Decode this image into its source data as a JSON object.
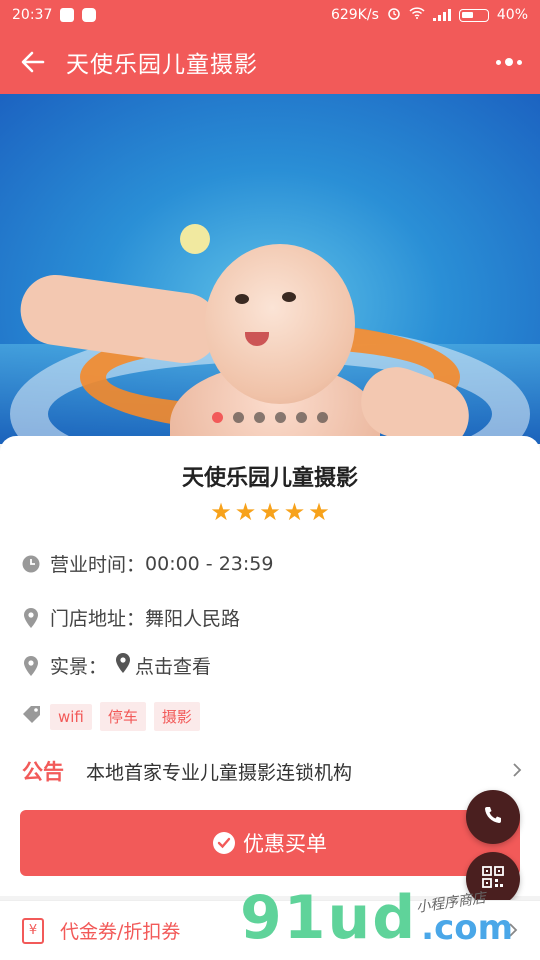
{
  "status_bar": {
    "time": "20:37",
    "network_speed": "629K/s",
    "battery": "40%",
    "icons": [
      "shield-app-icon",
      "wechat-icon",
      "alarm-icon",
      "wifi-icon",
      "signal-icon",
      "battery-icon"
    ]
  },
  "nav": {
    "title": "天使乐园儿童摄影",
    "back_icon": "back-arrow-icon",
    "more_icon": "more-dots-icon"
  },
  "carousel": {
    "total": 6,
    "active_index": 0
  },
  "shop": {
    "name": "天使乐园儿童摄影",
    "rating": 5,
    "hours_label": "营业时间：",
    "hours_value": "00:00 - 23:59",
    "address_label": "门店地址：",
    "address_value": "舞阳人民路",
    "view_label": "实景：",
    "view_link": "点击查看",
    "tags": [
      "wifi",
      "停车",
      "摄影"
    ]
  },
  "notice": {
    "label": "公告",
    "text": "本地首家专业儿童摄影连锁机构"
  },
  "buy_button": {
    "label": "优惠买单"
  },
  "coupon_bar": {
    "label": "代金券/折扣券"
  },
  "watermark": {
    "main": "91ud",
    "suffix": ".com",
    "script": "小程序商店"
  },
  "colors": {
    "brand": "#f25a59",
    "star": "#f7a21b",
    "fab": "#4a1f1f"
  }
}
